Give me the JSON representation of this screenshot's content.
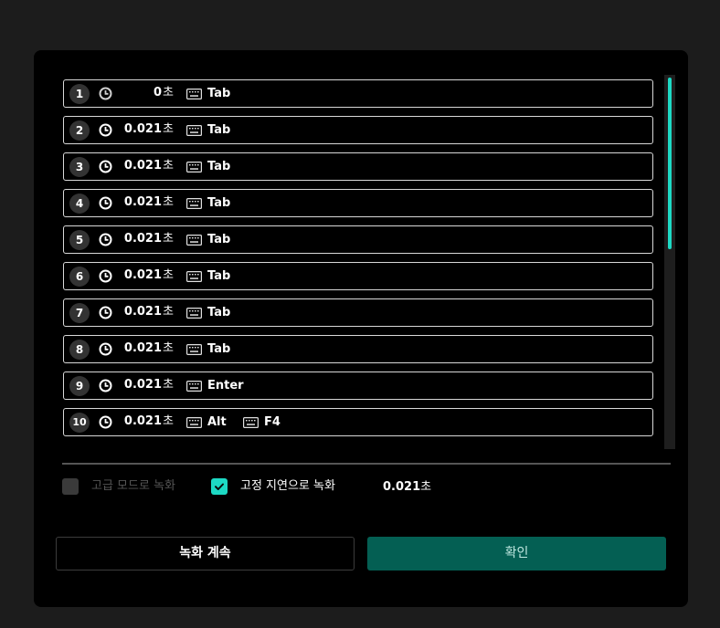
{
  "rows": [
    {
      "index": "1",
      "delay_value": "0",
      "delay_unit": "초",
      "keys": [
        "Tab"
      ],
      "clock_dim": true
    },
    {
      "index": "2",
      "delay_value": "0.021",
      "delay_unit": "초",
      "keys": [
        "Tab"
      ]
    },
    {
      "index": "3",
      "delay_value": "0.021",
      "delay_unit": "초",
      "keys": [
        "Tab"
      ]
    },
    {
      "index": "4",
      "delay_value": "0.021",
      "delay_unit": "초",
      "keys": [
        "Tab"
      ]
    },
    {
      "index": "5",
      "delay_value": "0.021",
      "delay_unit": "초",
      "keys": [
        "Tab"
      ]
    },
    {
      "index": "6",
      "delay_value": "0.021",
      "delay_unit": "초",
      "keys": [
        "Tab"
      ]
    },
    {
      "index": "7",
      "delay_value": "0.021",
      "delay_unit": "초",
      "keys": [
        "Tab"
      ]
    },
    {
      "index": "8",
      "delay_value": "0.021",
      "delay_unit": "초",
      "keys": [
        "Tab"
      ]
    },
    {
      "index": "9",
      "delay_value": "0.021",
      "delay_unit": "초",
      "keys": [
        "Enter"
      ]
    },
    {
      "index": "10",
      "delay_value": "0.021",
      "delay_unit": "초",
      "keys": [
        "Alt",
        "F4"
      ]
    }
  ],
  "options": {
    "advanced_mode": {
      "label": "고급 모드로 녹화",
      "checked": false,
      "enabled": false
    },
    "fixed_delay": {
      "label": "고정 지연으로 녹화",
      "checked": true,
      "enabled": true
    },
    "fixed_delay_value": "0.021",
    "fixed_delay_unit": "초"
  },
  "buttons": {
    "continue_label": "녹화 계속",
    "ok_label": "확인"
  },
  "colors": {
    "accent": "#1dd9c4",
    "ok_button": "#045f53",
    "background": "#000000"
  },
  "icons": {
    "delay": "clock-icon",
    "key": "keyboard-icon",
    "check": "checkmark-icon"
  }
}
